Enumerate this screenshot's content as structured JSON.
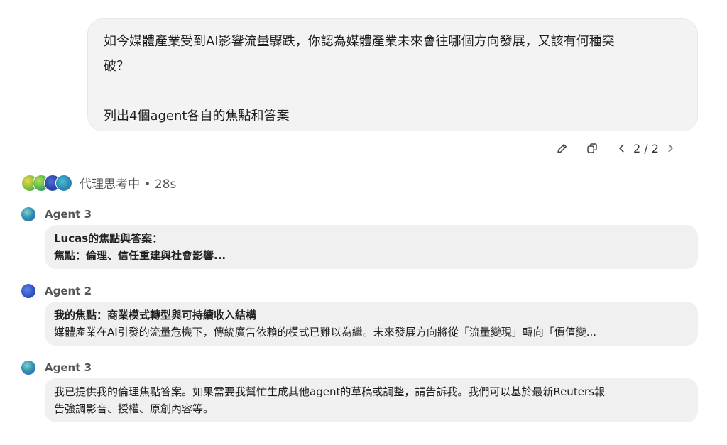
{
  "user_message": {
    "line1": "如今媒體產業受到AI影響流量驟跌，你認為媒體產業未來會往哪個方向發展，又該有何種突",
    "line2": "破？",
    "line3": "列出4個agent各自的焦點和答案"
  },
  "message_actions": {
    "edit_icon": "pencil-icon",
    "copy_icon": "copy-icon",
    "pager": "2 / 2"
  },
  "thinking": {
    "label": "代理思考中 • 28s"
  },
  "agents": [
    {
      "name": "Agent 3",
      "line1": "Lucas的焦點與答案：",
      "line2": "焦點：倫理、信任重建與社會影響..."
    },
    {
      "name": "Agent 2",
      "line1": "我的焦點：商業模式轉型與可持續收入結構",
      "line2": "媒體產業在AI引發的流量危機下，傳統廣告依賴的模式已難以為繼。未來發展方向將從「流量變現」轉向「價值變..."
    },
    {
      "name": "Agent 3",
      "line1": "我已提供我的倫理焦點答案。如果需要我幫忙生成其他agent的草稿或調整，請告訴我。我們可以基於最新Reuters報",
      "line2": "告強調影音、授權、原創內容等。"
    }
  ]
}
